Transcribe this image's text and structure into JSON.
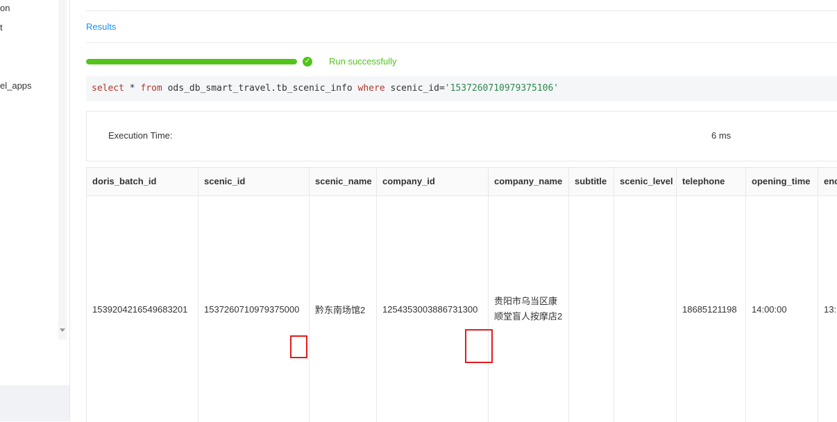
{
  "sidebar": {
    "items": [
      "on",
      "t",
      "el_apps"
    ]
  },
  "tabs": {
    "results": "Results"
  },
  "progress": {
    "percent": 100,
    "status": "Run successfully"
  },
  "query": {
    "parts": [
      {
        "t": "kw",
        "v": "select"
      },
      {
        "t": "txt",
        "v": " * "
      },
      {
        "t": "kw",
        "v": "from"
      },
      {
        "t": "txt",
        "v": " ods_db_smart_travel.tb_scenic_info "
      },
      {
        "t": "kw",
        "v": "where"
      },
      {
        "t": "txt",
        "v": " scenic_id="
      },
      {
        "t": "str",
        "v": "'1537260710979375106'"
      }
    ]
  },
  "execution": {
    "label": "Execution Time:",
    "value": "6 ms"
  },
  "table": {
    "columns": [
      "doris_batch_id",
      "scenic_id",
      "scenic_name",
      "company_id",
      "company_name",
      "subtitle",
      "scenic_level",
      "telephone",
      "opening_time",
      "enc"
    ],
    "row": [
      "1539204216549683201",
      "1537260710979375000",
      "黔东南场馆2",
      "1254353003886731300",
      "贵阳市乌当区康顺堂盲人按摩店2",
      "",
      "",
      "18685121198",
      "14:00:00",
      "13:"
    ]
  },
  "colors": {
    "accent": "#1890ff",
    "success": "#52c41a",
    "highlight": "#e21b1b"
  }
}
